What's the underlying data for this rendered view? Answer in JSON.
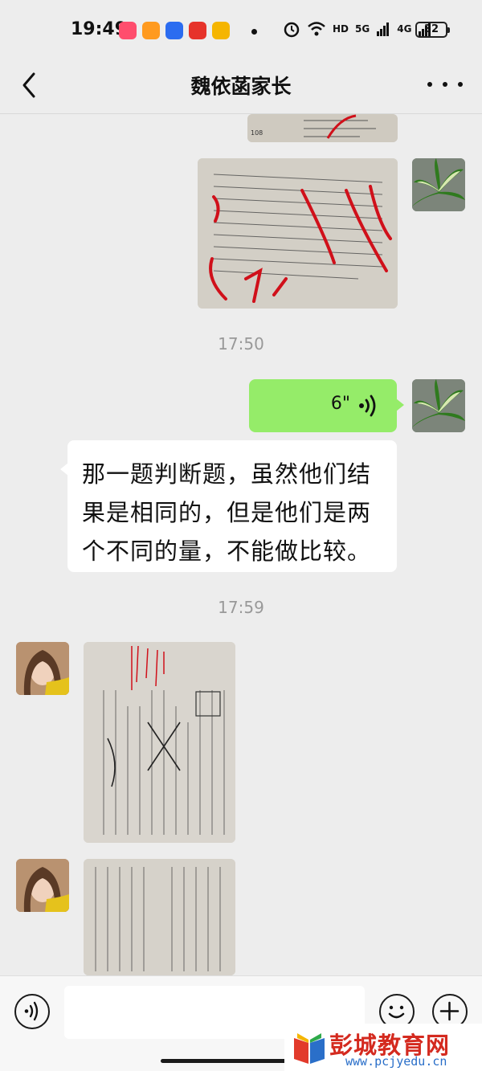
{
  "status_bar": {
    "time": "19:49",
    "network_1": "HD",
    "network_2": "5G",
    "network_3": "4G",
    "battery": "32"
  },
  "nav": {
    "title": "魏依菡家长"
  },
  "chat": {
    "timestamps": [
      "17:50",
      "17:59"
    ],
    "voice_message": {
      "duration": "6\""
    },
    "text_message": {
      "lines": [
        "那一题判断题，虽然他们结",
        "果是相同的，但是他们是两",
        "个不同的量，不能做比较。"
      ]
    }
  },
  "input_bar": {
    "placeholder": ""
  },
  "watermark": {
    "name": "彭城教育网",
    "url": "www.pcjyedu.cn"
  },
  "colors": {
    "self_bubble": "#95ec69",
    "other_bubble": "#ffffff",
    "background": "#ededed",
    "watermark_red": "#d42a1f"
  }
}
